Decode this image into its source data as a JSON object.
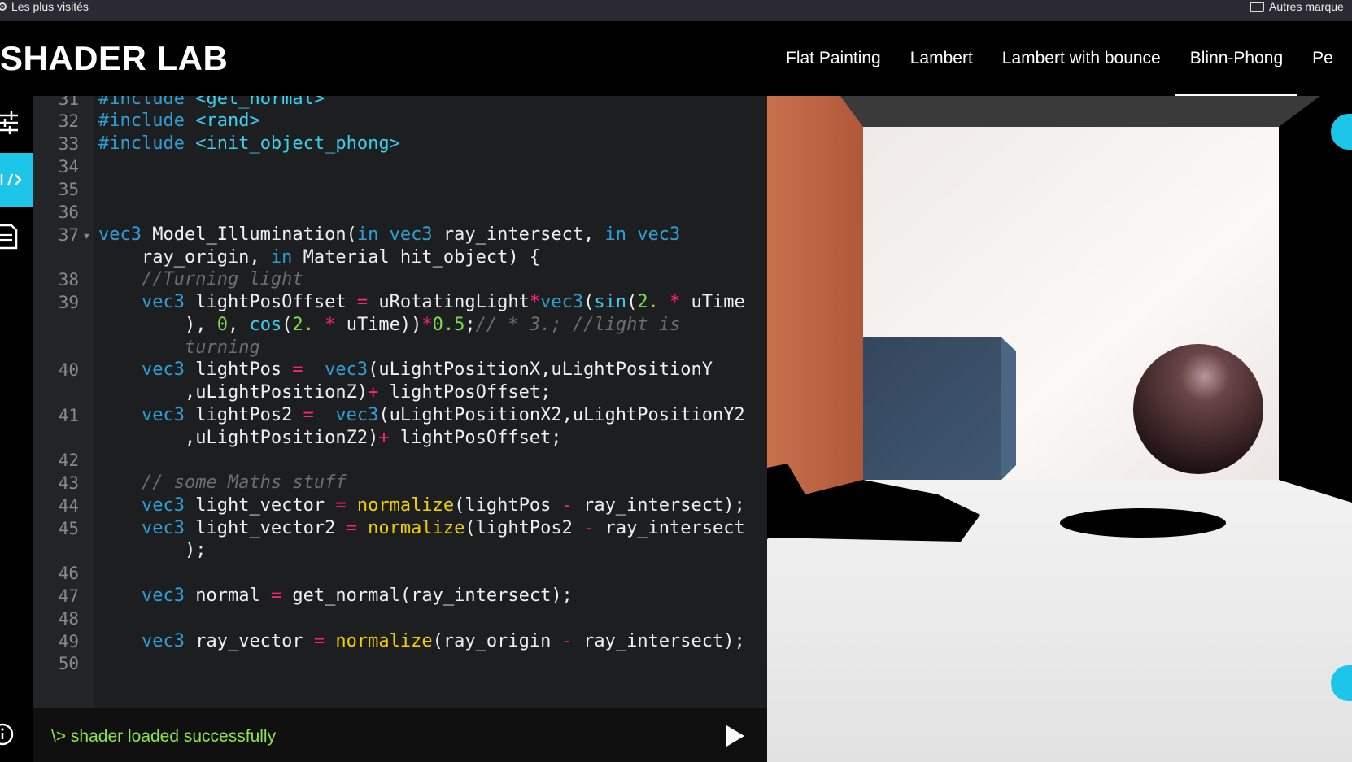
{
  "bookmarks": {
    "left_label": "Les plus visités",
    "right_label": "Autres marque",
    "left_icon": "gear-icon",
    "right_icon": "folder-icon"
  },
  "app": {
    "title": "SHADER LAB"
  },
  "nav": {
    "items": [
      {
        "label": "Flat Painting"
      },
      {
        "label": "Lambert"
      },
      {
        "label": "Lambert with bounce"
      },
      {
        "label": "Blinn-Phong"
      },
      {
        "label": "Pe"
      }
    ],
    "active": "Blinn-Phong"
  },
  "sidebar": {
    "items": [
      {
        "icon": "sliders-icon"
      },
      {
        "icon": "code-icon",
        "active": true
      },
      {
        "icon": "document-icon"
      },
      {
        "icon": "info-icon"
      }
    ]
  },
  "editor": {
    "line_numbers": [
      "31",
      "32",
      "33",
      "34",
      "35",
      "36",
      "37",
      "38",
      "39",
      "40",
      "41",
      "42",
      "43",
      "44",
      "45",
      "46",
      "47",
      "48",
      "49",
      "50"
    ]
  },
  "status": {
    "message": "\\> shader loaded successfully"
  },
  "colors": {
    "accent": "#1dc5e8",
    "status_green": "#8fe44b",
    "keyword": "#2e9fd6",
    "operator": "#f92672",
    "number": "#7ddc4e",
    "function": "#f0d000",
    "comment": "#6e6e6e"
  }
}
